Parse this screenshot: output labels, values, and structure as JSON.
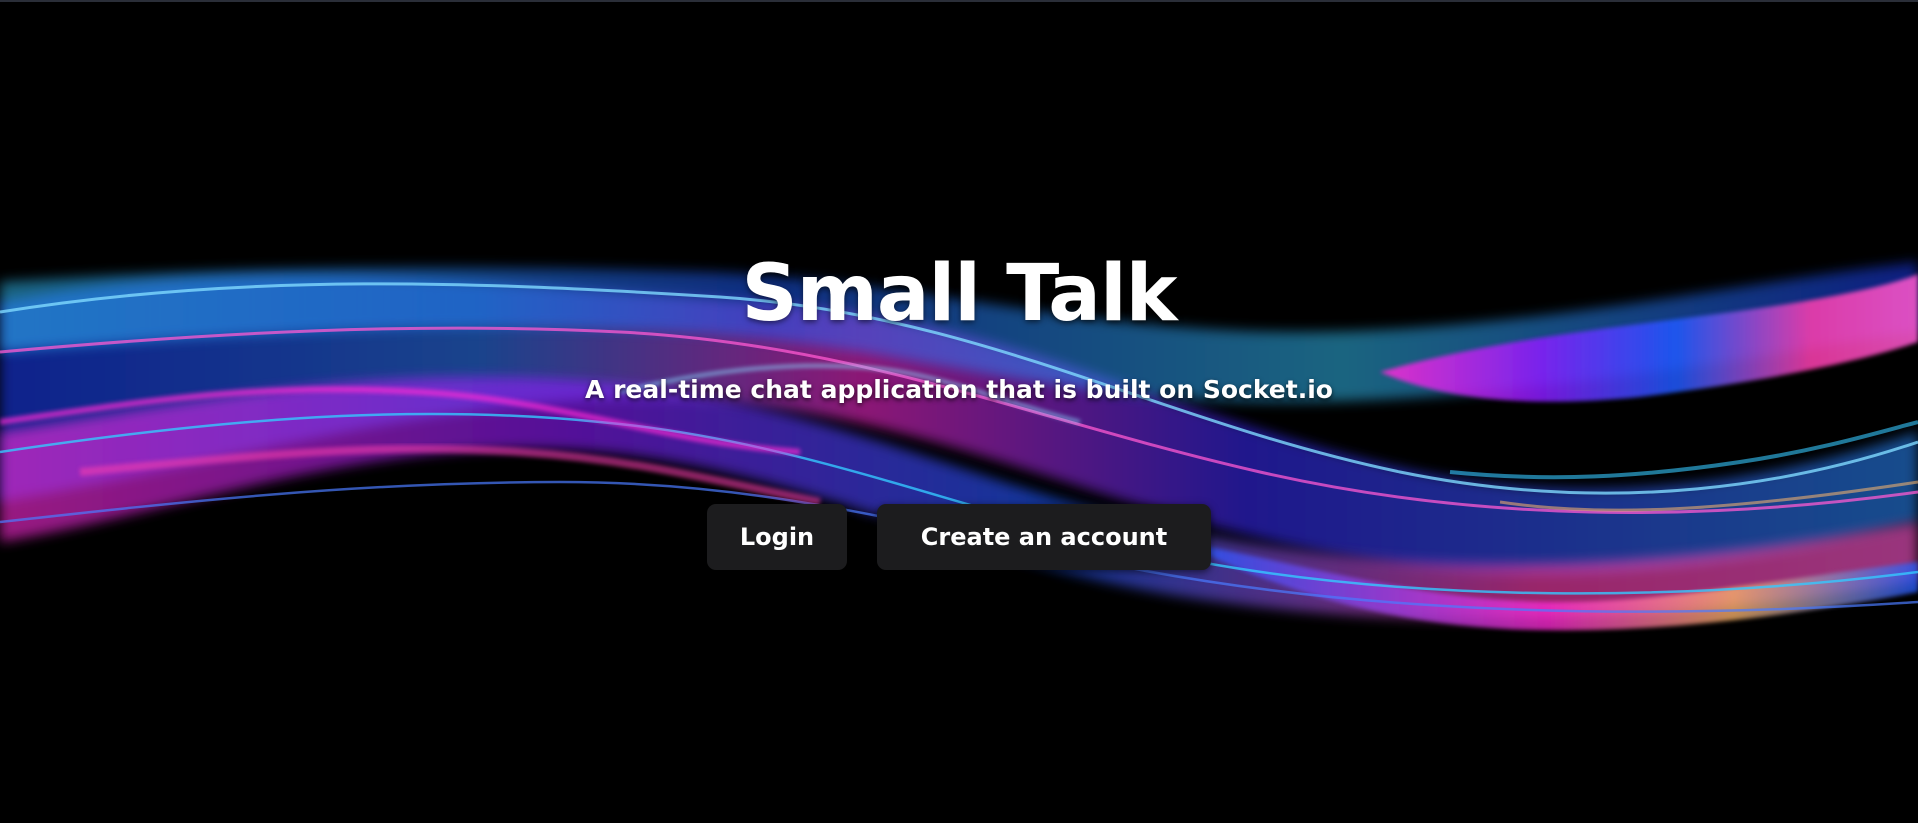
{
  "hero": {
    "title": "Small Talk",
    "subtitle": "A real-time chat application that is built on Socket.io"
  },
  "actions": {
    "login_label": "Login",
    "create_account_label": "Create an account"
  },
  "colors": {
    "background": "#000000",
    "button_background": "#1c1c1e",
    "text": "#ffffff",
    "wave_blue": "#1e5bff",
    "wave_cyan": "#35c8ff",
    "wave_magenta": "#ff2bd6",
    "wave_orange": "#ffb86b"
  }
}
